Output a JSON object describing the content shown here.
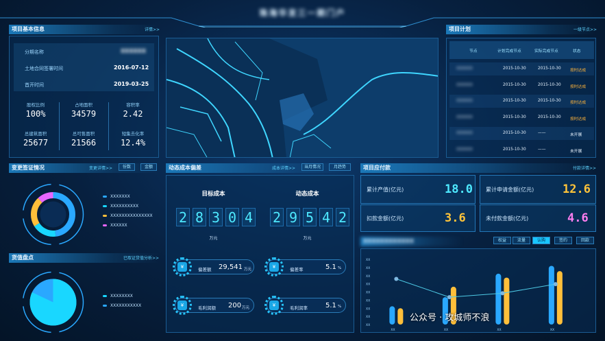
{
  "header": {
    "title": "珠海华发三一期门户"
  },
  "project_info": {
    "title": "项目基本信息",
    "link": "详情>>",
    "rows": [
      {
        "label": "分期名称",
        "value": "XXXXXX"
      },
      {
        "label": "土地合同签署时间",
        "value": "2016-07-12"
      },
      {
        "label": "首开时间",
        "value": "2019-03-25"
      }
    ],
    "stats": [
      {
        "label": "股权比例",
        "value": "100%"
      },
      {
        "label": "占地面积",
        "value": "34579"
      },
      {
        "label": "容积率",
        "value": "2.42"
      },
      {
        "label": "总建筑面积",
        "value": "25677"
      },
      {
        "label": "总可售面积",
        "value": "21566"
      },
      {
        "label": "短集去化率",
        "value": "12.4%"
      }
    ]
  },
  "project_plan": {
    "title": "项目计划",
    "link": "一级节点>>",
    "headers": [
      "节点",
      "计划完成节点",
      "实际完成节点",
      "状态"
    ],
    "rows": [
      {
        "node": "XXXXXX",
        "plan": "2015-10-30",
        "actual": "2015-10-30",
        "status": "按时达成",
        "color": "#ffb43a"
      },
      {
        "node": "XXXXXX",
        "plan": "2015-10-30",
        "actual": "2015-10-30",
        "status": "按时达成",
        "color": "#ffb43a"
      },
      {
        "node": "XXXXXX",
        "plan": "2015-10-30",
        "actual": "2015-10-30",
        "status": "按时达成",
        "color": "#ffb43a"
      },
      {
        "node": "XXXXXX",
        "plan": "2015-10-30",
        "actual": "2015-10-30",
        "status": "按时达成",
        "color": "#ffb43a"
      },
      {
        "node": "XXXXXX",
        "plan": "2015-10-30",
        "actual": "——",
        "status": "未开展",
        "color": "#e8f4ff"
      },
      {
        "node": "XXXXXX",
        "plan": "2015-10-30",
        "actual": "——",
        "status": "未开展",
        "color": "#e8f4ff"
      }
    ]
  },
  "change_visa": {
    "title": "变更签证情况",
    "link": "变更详情>>",
    "btn1": "份数",
    "btn2": "金额",
    "legend": [
      "XXXXXXX",
      "XXXXXXXXXX",
      "XXXXXXXXXXXXXXX",
      "XXXXXX"
    ],
    "colors": [
      "#2aa8ff",
      "#19d7ff",
      "#ffbf3a",
      "#e866ff"
    ],
    "shares": [
      0.48,
      0.18,
      0.22,
      0.12
    ]
  },
  "cargo": {
    "title": "货值盘点",
    "link": "已取证货值分析>>",
    "legend": [
      "XXXXXXXX",
      "XXXXXXXXXXX"
    ],
    "colors": [
      "#19d7ff",
      "#2aa8ff"
    ],
    "share": 0.82
  },
  "cost": {
    "title": "动态成本偏差",
    "link": "成本详情>>",
    "btn1": "当月情况",
    "btn2": "月趋势",
    "target_label": "目标成本",
    "dynamic_label": "动态成本",
    "target_digits": [
      "2",
      "8",
      "3",
      "0",
      "4"
    ],
    "dynamic_digits": [
      "2",
      "9",
      "5",
      "4",
      "2"
    ],
    "unit": "万元",
    "metrics": [
      {
        "label": "偏差额",
        "value": "29,541",
        "unit": "万元"
      },
      {
        "label": "偏差率",
        "value": "5.1",
        "unit": "%"
      },
      {
        "label": "毛利润额",
        "value": "200",
        "unit": "万元"
      },
      {
        "label": "毛利润率",
        "value": "5.1",
        "unit": "%"
      }
    ]
  },
  "payment": {
    "title": "项目应付款",
    "link": "付款详情>>",
    "cards": [
      {
        "label": "累计产值(亿元)",
        "value": "18.0",
        "color": "#4ee9ff"
      },
      {
        "label": "累计申请金额(亿元)",
        "value": "12.6",
        "color": "#ffc43a"
      },
      {
        "label": "扣款金额(亿元)",
        "value": "3.6",
        "color": "#ffc43a"
      },
      {
        "label": "未付款金额(亿元)",
        "value": "4.6",
        "color": "#ff7ef0"
      }
    ]
  },
  "sales": {
    "title": "XXXXXXXXXXXX",
    "tabs": [
      "权益",
      "流量",
      "认购",
      "签约",
      "回款"
    ],
    "active": 2
  },
  "chart_data": {
    "type": "bar",
    "categories": [
      "XX",
      "XX",
      "XX",
      "XX"
    ],
    "ylabels": [
      "XX",
      "XX",
      "XX",
      "XX",
      "XX",
      "XX",
      "XX",
      "XX",
      "XX"
    ],
    "series": [
      {
        "values": [
          0.28,
          0.42,
          0.78,
          0.9
        ],
        "color": "#2aa8ff"
      },
      {
        "values": [
          0.25,
          0.58,
          0.72,
          0.82
        ],
        "color": "#ffbf3a"
      }
    ],
    "line": [
      0.7,
      0.42,
      0.48,
      0.62
    ],
    "ylim": [
      0,
      1
    ]
  },
  "watermark": "公众号 · 攻城师不浪"
}
